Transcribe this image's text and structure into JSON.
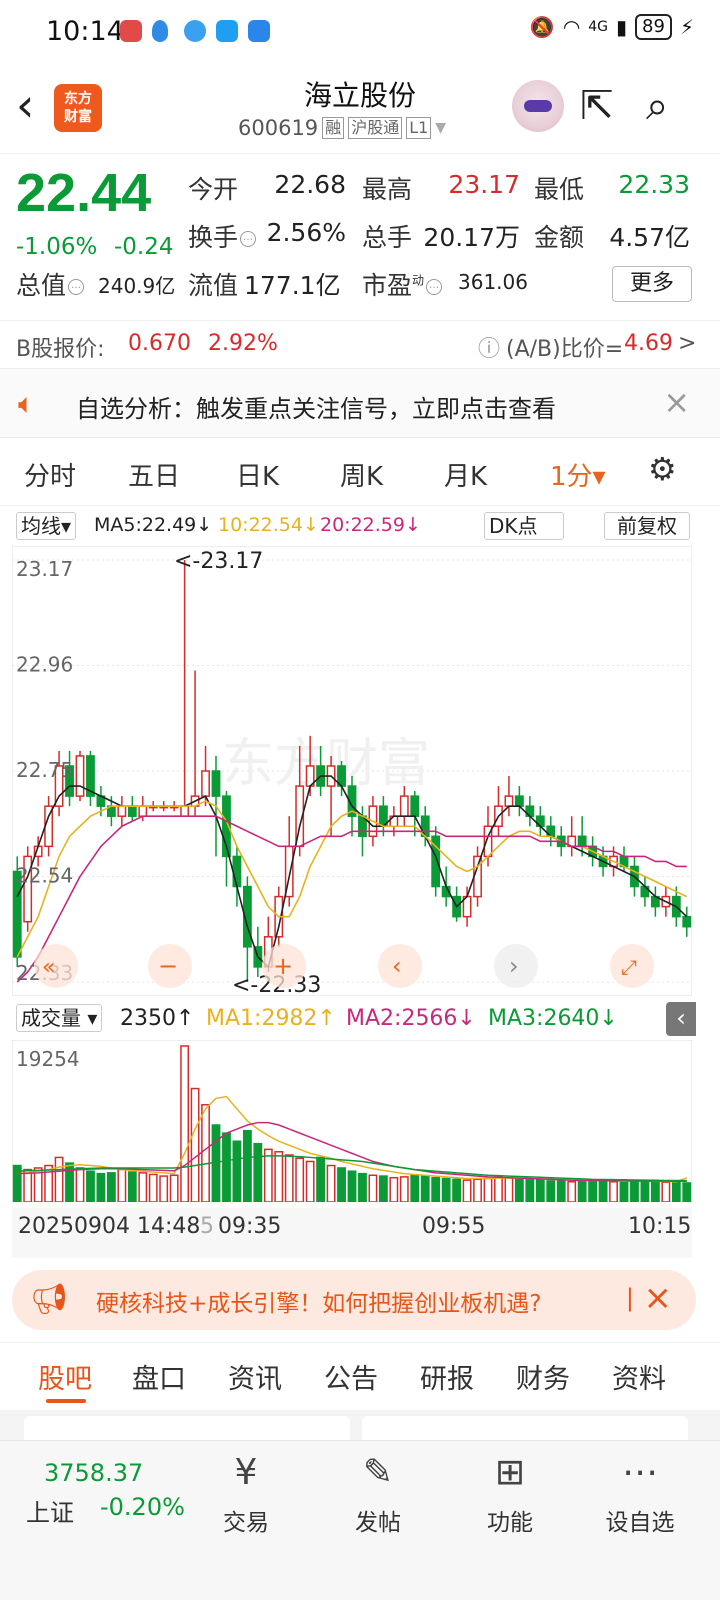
{
  "status": {
    "time": "10:14",
    "signal": "4G",
    "battery": "89"
  },
  "header": {
    "logo_line1": "东方",
    "logo_line2": "财富",
    "name": "海立股份",
    "code": "600619",
    "tags": [
      "融",
      "沪股通",
      "L1"
    ]
  },
  "quote": {
    "price": "22.44",
    "change_pct": "-1.06%",
    "change_amt": "-0.24",
    "open_label": "今开",
    "open": "22.68",
    "high_label": "最高",
    "high": "23.17",
    "low_label": "最低",
    "low": "22.33",
    "turnover_label": "换手",
    "turnover": "2.56%",
    "volume_label": "总手",
    "volume": "20.17万",
    "amount_label": "金额",
    "amount": "4.57亿",
    "mktcap_label": "总值",
    "mktcap": "240.9亿",
    "float_label": "流值",
    "float": "177.1亿",
    "pe_label": "市盈",
    "pe_sup": "动",
    "pe": "361.06",
    "more": "更多"
  },
  "bshare": {
    "label": "B股报价:",
    "price": "0.670",
    "pct": "2.92%",
    "ratio_label": "(A/B)比价=",
    "ratio": "4.69",
    "arrow": ">"
  },
  "notice": {
    "text": "自选分析：触发重点关注信号，立即点击查看"
  },
  "chart_tabs": [
    "分时",
    "五日",
    "日K",
    "周K",
    "月K",
    "1分▾"
  ],
  "ma": {
    "selector": "均线▾",
    "ma5": "MA5:22.49↓",
    "ma10": "10:22.54↓",
    "ma20": "20:22.59↓",
    "dk": "DK点",
    "fq": "前复权"
  },
  "volume": {
    "selector": "成交量 ▾",
    "current": "2350↑",
    "ma1": "MA1:2982↑",
    "ma2": "MA2:2566↓",
    "ma3": "MA3:2640↓"
  },
  "time_axis": [
    "20250904 14:48",
    "5",
    "09:35",
    "09:55",
    "10:15"
  ],
  "promo": {
    "text": "硬核科技+成长引擎！如何把握创业板机遇?"
  },
  "bottom_tabs": [
    "股吧",
    "盘口",
    "资讯",
    "公告",
    "研报",
    "财务",
    "资料"
  ],
  "nav": {
    "index_value": "3758.37",
    "index_name": "上证",
    "index_change": "-0.20%",
    "items": [
      "交易",
      "发帖",
      "功能",
      "设自选"
    ]
  },
  "colors": {
    "up": "#d62b2b",
    "down": "#0a9a36",
    "accent": "#e8551a",
    "ma5": "#222222",
    "ma10": "#e8b21f",
    "ma20": "#c9287a"
  },
  "chart_data": {
    "type": "candlestick",
    "y_ticks": [
      "23.17",
      "22.96",
      "22.75",
      "22.54",
      "22.33"
    ],
    "ylim": [
      22.33,
      23.17
    ],
    "high_annot": "<-23.17",
    "low_annot": "<-22.33",
    "candles": [
      [
        22.55,
        22.38,
        22.58,
        22.36
      ],
      [
        22.45,
        22.58,
        22.6,
        22.43
      ],
      [
        22.58,
        22.6,
        22.62,
        22.56
      ],
      [
        22.6,
        22.68,
        22.7,
        22.58
      ],
      [
        22.68,
        22.76,
        22.79,
        22.66
      ],
      [
        22.76,
        22.7,
        22.79,
        22.68
      ],
      [
        22.7,
        22.78,
        22.79,
        22.69
      ],
      [
        22.78,
        22.7,
        22.79,
        22.68
      ],
      [
        22.7,
        22.68,
        22.72,
        22.66
      ],
      [
        22.68,
        22.66,
        22.7,
        22.64
      ],
      [
        22.66,
        22.68,
        22.7,
        22.64
      ],
      [
        22.68,
        22.66,
        22.7,
        22.65
      ],
      [
        22.66,
        22.68,
        22.7,
        22.65
      ],
      [
        22.68,
        22.68,
        22.69,
        22.67
      ],
      [
        22.68,
        22.68,
        22.69,
        22.67
      ],
      [
        22.68,
        22.68,
        22.69,
        22.67
      ],
      [
        22.66,
        22.68,
        23.17,
        22.66
      ],
      [
        22.68,
        22.7,
        22.95,
        22.66
      ],
      [
        22.7,
        22.75,
        22.8,
        22.68
      ],
      [
        22.75,
        22.7,
        22.78,
        22.58
      ],
      [
        22.7,
        22.58,
        22.71,
        22.52
      ],
      [
        22.58,
        22.52,
        22.6,
        22.48
      ],
      [
        22.52,
        22.4,
        22.54,
        22.33
      ],
      [
        22.4,
        22.36,
        22.44,
        22.34
      ],
      [
        22.36,
        22.42,
        22.46,
        22.35
      ],
      [
        22.42,
        22.5,
        22.52,
        22.4
      ],
      [
        22.5,
        22.6,
        22.66,
        22.48
      ],
      [
        22.6,
        22.72,
        22.8,
        22.58
      ],
      [
        22.72,
        22.76,
        22.82,
        22.7
      ],
      [
        22.76,
        22.72,
        22.8,
        22.7
      ],
      [
        22.72,
        22.76,
        22.78,
        22.62
      ],
      [
        22.76,
        22.72,
        22.77,
        22.7
      ],
      [
        22.72,
        22.66,
        22.74,
        22.62
      ],
      [
        22.66,
        22.62,
        22.68,
        22.58
      ],
      [
        22.62,
        22.68,
        22.7,
        22.6
      ],
      [
        22.68,
        22.64,
        22.7,
        22.62
      ],
      [
        22.64,
        22.66,
        22.68,
        22.62
      ],
      [
        22.66,
        22.7,
        22.72,
        22.64
      ],
      [
        22.7,
        22.66,
        22.71,
        22.62
      ],
      [
        22.66,
        22.62,
        22.68,
        22.6
      ],
      [
        22.62,
        22.52,
        22.64,
        22.5
      ],
      [
        22.52,
        22.5,
        22.56,
        22.48
      ],
      [
        22.5,
        22.46,
        22.52,
        22.45
      ],
      [
        22.46,
        22.5,
        22.52,
        22.44
      ],
      [
        22.5,
        22.58,
        22.6,
        22.48
      ],
      [
        22.58,
        22.64,
        22.68,
        22.56
      ],
      [
        22.64,
        22.68,
        22.72,
        22.62
      ],
      [
        22.68,
        22.7,
        22.74,
        22.66
      ],
      [
        22.7,
        22.68,
        22.72,
        22.66
      ],
      [
        22.68,
        22.66,
        22.7,
        22.64
      ],
      [
        22.66,
        22.64,
        22.68,
        22.62
      ],
      [
        22.64,
        22.62,
        22.66,
        22.6
      ],
      [
        22.62,
        22.6,
        22.64,
        22.58
      ],
      [
        22.6,
        22.62,
        22.66,
        22.58
      ],
      [
        22.62,
        22.6,
        22.66,
        22.58
      ],
      [
        22.6,
        22.58,
        22.62,
        22.56
      ],
      [
        22.58,
        22.56,
        22.6,
        22.54
      ],
      [
        22.56,
        22.58,
        22.6,
        22.54
      ],
      [
        22.58,
        22.56,
        22.6,
        22.55
      ],
      [
        22.56,
        22.52,
        22.58,
        22.5
      ],
      [
        22.52,
        22.5,
        22.54,
        22.48
      ],
      [
        22.5,
        22.48,
        22.52,
        22.46
      ],
      [
        22.48,
        22.5,
        22.52,
        22.46
      ],
      [
        22.5,
        22.46,
        22.52,
        22.44
      ],
      [
        22.46,
        22.44,
        22.48,
        22.42
      ]
    ],
    "ma5": [
      22.5,
      22.54,
      22.6,
      22.66,
      22.7,
      22.72,
      22.72,
      22.71,
      22.7,
      22.69,
      22.68,
      22.68,
      22.68,
      22.68,
      22.68,
      22.68,
      22.68,
      22.69,
      22.7,
      22.66,
      22.6,
      22.52,
      22.44,
      22.38,
      22.36,
      22.44,
      22.54,
      22.64,
      22.72,
      22.74,
      22.74,
      22.72,
      22.68,
      22.66,
      22.64,
      22.64,
      22.66,
      22.66,
      22.66,
      22.62,
      22.58,
      22.52,
      22.48,
      22.5,
      22.56,
      22.62,
      22.66,
      22.68,
      22.68,
      22.66,
      22.64,
      22.62,
      22.61,
      22.6,
      22.59,
      22.58,
      22.57,
      22.56,
      22.55,
      22.54,
      22.52,
      22.5,
      22.49,
      22.48,
      22.46
    ],
    "ma10": [
      22.38,
      22.42,
      22.46,
      22.52,
      22.58,
      22.62,
      22.64,
      22.66,
      22.67,
      22.68,
      22.68,
      22.68,
      22.68,
      22.68,
      22.68,
      22.68,
      22.68,
      22.68,
      22.69,
      22.68,
      22.65,
      22.6,
      22.56,
      22.52,
      22.48,
      22.46,
      22.46,
      22.5,
      22.56,
      22.6,
      22.64,
      22.66,
      22.67,
      22.66,
      22.65,
      22.64,
      22.64,
      22.64,
      22.64,
      22.62,
      22.6,
      22.58,
      22.56,
      22.55,
      22.56,
      22.58,
      22.6,
      22.62,
      22.63,
      22.63,
      22.62,
      22.62,
      22.61,
      22.6,
      22.6,
      22.59,
      22.58,
      22.57,
      22.56,
      22.55,
      22.54,
      22.53,
      22.52,
      22.51,
      22.5
    ],
    "ma20": [
      22.33,
      22.35,
      22.38,
      22.42,
      22.46,
      22.5,
      22.54,
      22.57,
      22.6,
      22.62,
      22.64,
      22.65,
      22.66,
      22.66,
      22.66,
      22.66,
      22.66,
      22.66,
      22.66,
      22.66,
      22.65,
      22.64,
      22.63,
      22.62,
      22.61,
      22.6,
      22.6,
      22.6,
      22.61,
      22.62,
      22.62,
      22.62,
      22.63,
      22.63,
      22.63,
      22.63,
      22.63,
      22.63,
      22.63,
      22.63,
      22.63,
      22.62,
      22.62,
      22.62,
      22.62,
      22.62,
      22.62,
      22.62,
      22.62,
      22.62,
      22.61,
      22.61,
      22.61,
      22.6,
      22.6,
      22.6,
      22.59,
      22.59,
      22.58,
      22.58,
      22.58,
      22.57,
      22.57,
      22.56,
      22.56
    ],
    "volume_ylim": [
      0,
      19254
    ],
    "volume_tick": "19254",
    "volumes": [
      4500,
      4000,
      4200,
      4500,
      5500,
      4800,
      4200,
      3800,
      3500,
      3600,
      4000,
      3700,
      3600,
      3400,
      3200,
      3300,
      19254,
      14000,
      12000,
      9500,
      8500,
      7500,
      8800,
      7200,
      6500,
      6200,
      5800,
      5400,
      5000,
      5500,
      4500,
      4200,
      3800,
      3500,
      3300,
      3200,
      3000,
      3100,
      3300,
      3200,
      3000,
      2900,
      2800,
      2700,
      2800,
      2900,
      3100,
      3000,
      2900,
      2800,
      2700,
      2600,
      2600,
      2500,
      2600,
      2700,
      2600,
      2500,
      2400,
      2450,
      2500,
      2400,
      2450,
      2400,
      2350
    ],
    "vma1": [
      3500,
      3600,
      3800,
      4000,
      4300,
      4500,
      4600,
      4500,
      4400,
      4200,
      4000,
      3900,
      3800,
      3700,
      3600,
      3500,
      6000,
      9000,
      11500,
      12800,
      13000,
      11500,
      10000,
      9000,
      8200,
      7500,
      7000,
      6500,
      6000,
      5700,
      5400,
      5000,
      4700,
      4400,
      4100,
      3900,
      3700,
      3500,
      3400,
      3300,
      3200,
      3100,
      3000,
      2900,
      2900,
      2900,
      2950,
      2950,
      2950,
      2900,
      2850,
      2800,
      2750,
      2700,
      2650,
      2650,
      2650,
      2650,
      2600,
      2600,
      2600,
      2550,
      2550,
      2500,
      2982
    ],
    "vma2": [
      3500,
      3550,
      3600,
      3700,
      3800,
      3900,
      4000,
      4050,
      4100,
      4100,
      4100,
      4050,
      4000,
      3950,
      3900,
      3850,
      4500,
      5500,
      6500,
      7500,
      8500,
      9000,
      9500,
      9800,
      9800,
      9500,
      9000,
      8500,
      8000,
      7500,
      7000,
      6500,
      6000,
      5500,
      5000,
      4700,
      4400,
      4200,
      4000,
      3800,
      3600,
      3500,
      3400,
      3300,
      3200,
      3100,
      3050,
      3000,
      2950,
      2900,
      2850,
      2800,
      2750,
      2700,
      2650,
      2650,
      2620,
      2600,
      2600,
      2580,
      2570,
      2570,
      2570,
      2566,
      2566
    ],
    "vma3": [
      3800,
      3850,
      3900,
      3950,
      4000,
      4050,
      4100,
      4150,
      4200,
      4200,
      4200,
      4200,
      4200,
      4200,
      4200,
      4200,
      4300,
      4500,
      4700,
      4900,
      5100,
      5300,
      5500,
      5600,
      5700,
      5700,
      5650,
      5600,
      5500,
      5400,
      5300,
      5200,
      5100,
      5000,
      4800,
      4600,
      4400,
      4200,
      4000,
      3900,
      3800,
      3700,
      3600,
      3500,
      3400,
      3300,
      3250,
      3200,
      3150,
      3100,
      3050,
      3000,
      2950,
      2900,
      2850,
      2800,
      2780,
      2760,
      2740,
      2720,
      2700,
      2680,
      2660,
      2650,
      2640
    ]
  }
}
